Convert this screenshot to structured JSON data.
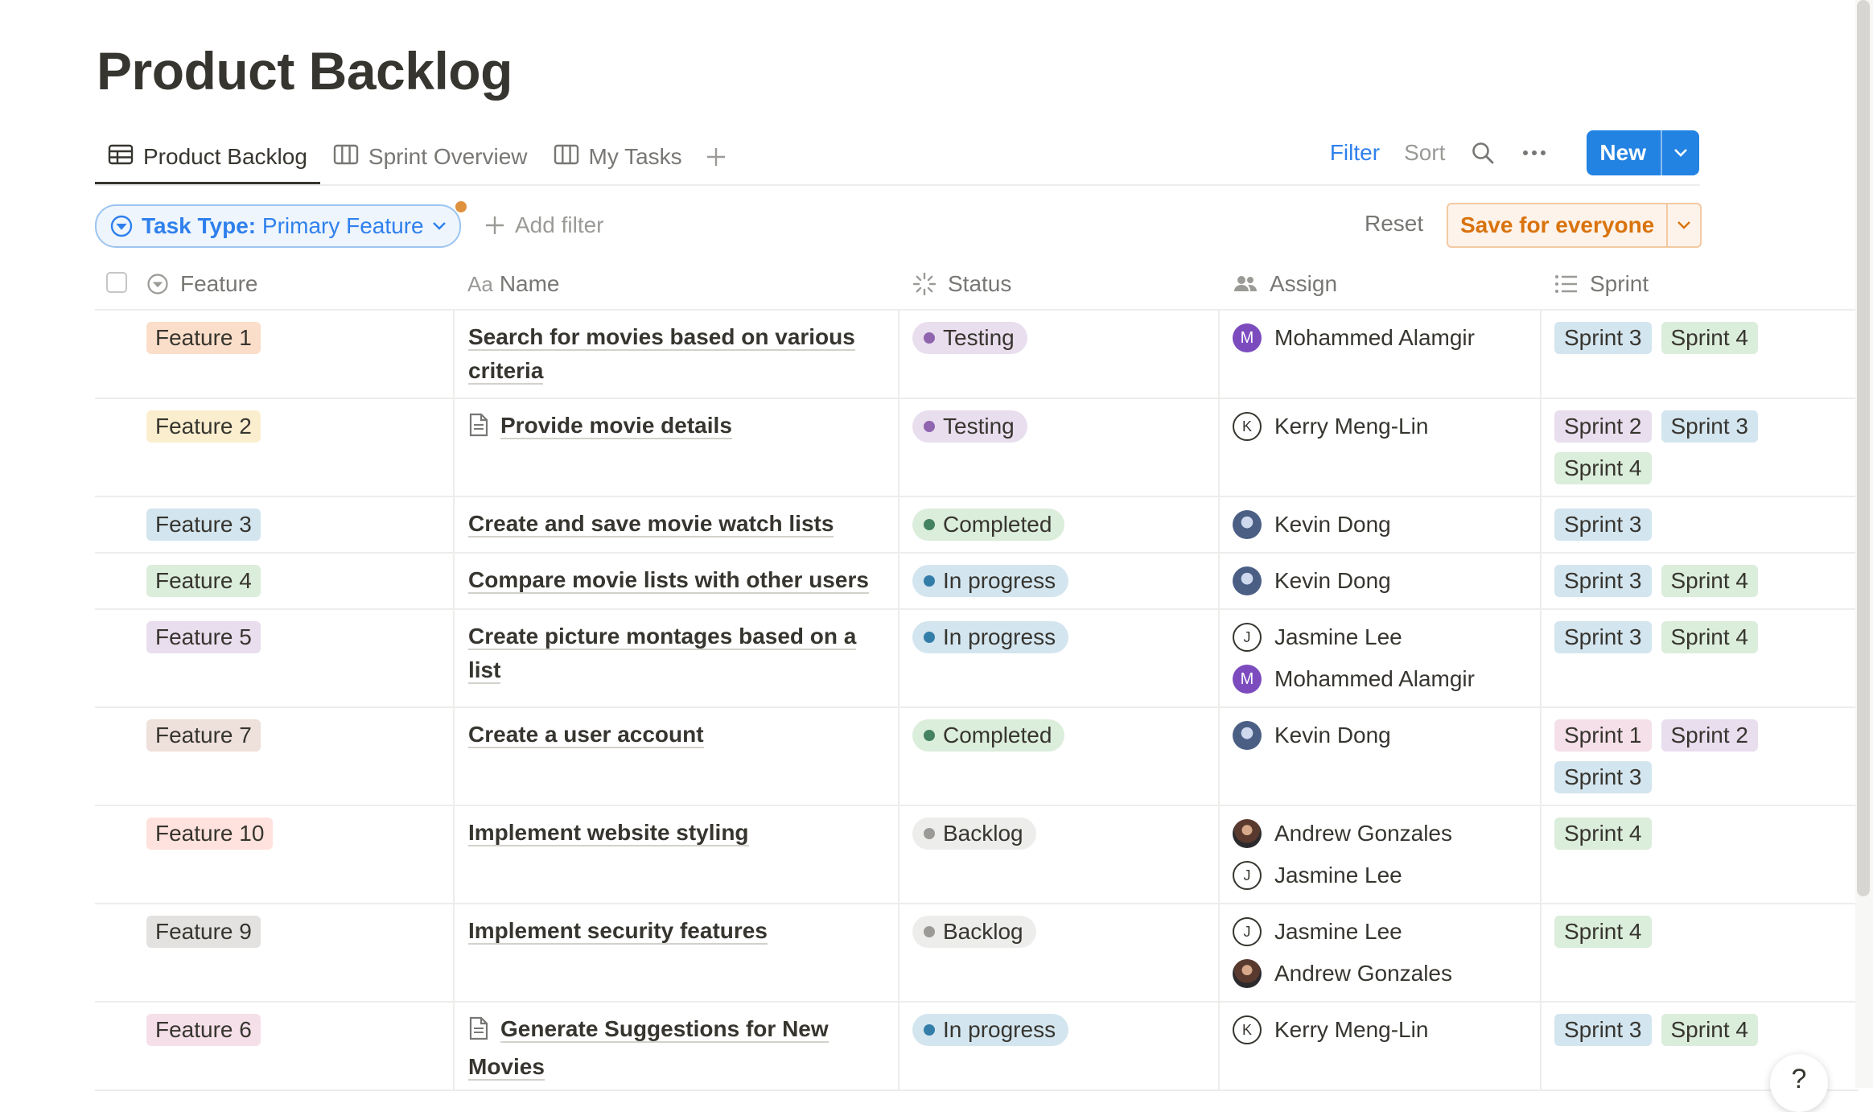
{
  "page": {
    "title": "Product Backlog"
  },
  "tabs": [
    {
      "label": "Product Backlog",
      "icon": "table-icon",
      "active": true
    },
    {
      "label": "Sprint Overview",
      "icon": "board-icon",
      "active": false
    },
    {
      "label": "My Tasks",
      "icon": "board-icon",
      "active": false
    }
  ],
  "toolbar": {
    "filter": "Filter",
    "sort": "Sort",
    "new": "New"
  },
  "filter_bar": {
    "pill_key": "Task Type:",
    "pill_value": "Primary Feature",
    "add_filter": "Add filter",
    "reset": "Reset",
    "save": "Save for everyone"
  },
  "columns": {
    "feature": "Feature",
    "name_prefix": "Aa",
    "name": "Name",
    "status": "Status",
    "assign": "Assign",
    "sprint": "Sprint"
  },
  "colors": {
    "accent": "#2383e2",
    "status": {
      "Testing": "#e8deee",
      "Completed": "#dbeddb",
      "In progress": "#d3e5ef",
      "Backlog": "#ededec"
    }
  },
  "rows": [
    {
      "feature": "Feature 1",
      "feature_bg": "#fadec9",
      "name": "Search for movies based on various criteria",
      "doc": false,
      "status": "Testing",
      "status_dot": "#9065b0",
      "assign": [
        {
          "name": "Mohammed Alamgir",
          "avatar": "M",
          "style": "fill"
        }
      ],
      "sprints": [
        "Sprint 3",
        "Sprint 4"
      ]
    },
    {
      "feature": "Feature 2",
      "feature_bg": "#fbeecf",
      "name": "Provide movie details",
      "doc": true,
      "status": "Testing",
      "status_dot": "#9065b0",
      "assign": [
        {
          "name": "Kerry Meng-Lin",
          "avatar": "K",
          "style": "outline"
        }
      ],
      "sprints": [
        "Sprint 2",
        "Sprint 3",
        "Sprint 4"
      ]
    },
    {
      "feature": "Feature 3",
      "feature_bg": "#d3e5ef",
      "name": "Create and save movie watch lists",
      "doc": false,
      "status": "Completed",
      "status_dot": "#448361",
      "assign": [
        {
          "name": "Kevin Dong",
          "avatar": "",
          "style": "photo-kd"
        }
      ],
      "sprints": [
        "Sprint 3"
      ]
    },
    {
      "feature": "Feature 4",
      "feature_bg": "#dbeddb",
      "name": "Compare movie lists with other users",
      "doc": false,
      "status": "In progress",
      "status_dot": "#337ea9",
      "assign": [
        {
          "name": "Kevin Dong",
          "avatar": "",
          "style": "photo-kd"
        }
      ],
      "sprints": [
        "Sprint 3",
        "Sprint 4"
      ]
    },
    {
      "feature": "Feature 5",
      "feature_bg": "#e8deee",
      "name": "Create picture montages based on a list",
      "doc": false,
      "status": "In progress",
      "status_dot": "#337ea9",
      "assign": [
        {
          "name": "Jasmine Lee",
          "avatar": "J",
          "style": "outline"
        },
        {
          "name": "Mohammed Alamgir",
          "avatar": "M",
          "style": "fill"
        }
      ],
      "sprints": [
        "Sprint 3",
        "Sprint 4"
      ]
    },
    {
      "feature": "Feature 7",
      "feature_bg": "#eee0da",
      "name": "Create a user account",
      "doc": false,
      "status": "Completed",
      "status_dot": "#448361",
      "assign": [
        {
          "name": "Kevin Dong",
          "avatar": "",
          "style": "photo-kd"
        }
      ],
      "sprints": [
        "Sprint 1",
        "Sprint 2",
        "Sprint 3"
      ]
    },
    {
      "feature": "Feature 10",
      "feature_bg": "#ffe2dd",
      "name": "Implement website styling",
      "doc": false,
      "status": "Backlog",
      "status_dot": "#9b9a97",
      "assign": [
        {
          "name": "Andrew Gonzales",
          "avatar": "",
          "style": "photo-ag"
        },
        {
          "name": "Jasmine Lee",
          "avatar": "J",
          "style": "outline"
        }
      ],
      "sprints": [
        "Sprint 4"
      ]
    },
    {
      "feature": "Feature 9",
      "feature_bg": "#e3e2e0",
      "name": "Implement security features",
      "doc": false,
      "status": "Backlog",
      "status_dot": "#9b9a97",
      "assign": [
        {
          "name": "Jasmine Lee",
          "avatar": "J",
          "style": "outline"
        },
        {
          "name": "Andrew Gonzales",
          "avatar": "",
          "style": "photo-ag"
        }
      ],
      "sprints": [
        "Sprint 4"
      ]
    },
    {
      "feature": "Feature 6",
      "feature_bg": "#f5e0e9",
      "name": "Generate Suggestions for New Movies",
      "doc": true,
      "status": "In progress",
      "status_dot": "#337ea9",
      "assign": [
        {
          "name": "Kerry Meng-Lin",
          "avatar": "K",
          "style": "outline"
        }
      ],
      "sprints": [
        "Sprint 3",
        "Sprint 4"
      ]
    }
  ],
  "sprint_colors": {
    "Sprint 1": "#f5e0e9",
    "Sprint 2": "#e8deee",
    "Sprint 3": "#d3e5ef",
    "Sprint 4": "#dbeddb"
  },
  "help": {
    "label": "?"
  }
}
